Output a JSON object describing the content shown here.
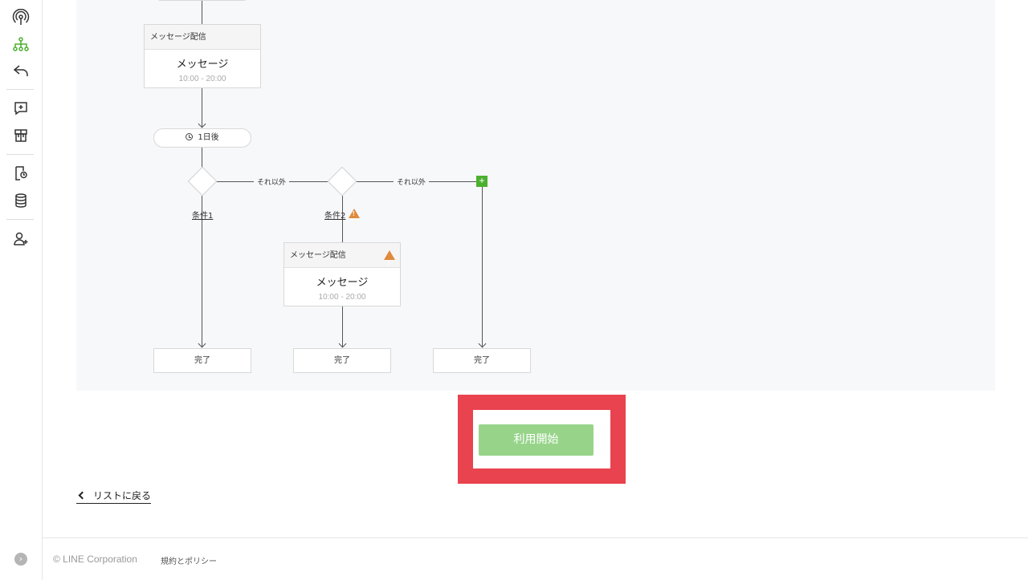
{
  "sidebar": {
    "icons": [
      "broadcast-icon",
      "flow-icon",
      "reply-icon",
      "add-message-icon",
      "gift-icon",
      "document-icon",
      "database-icon",
      "add-user-icon"
    ],
    "expand": "›",
    "accent": "#4cb02f"
  },
  "flow": {
    "message1": {
      "header": "メッセージ配信",
      "title": "メッセージ",
      "time": "10:00 - 20:00"
    },
    "wait": {
      "label": "1日後"
    },
    "else1": "それ以外",
    "else2": "それ以外",
    "cond1": "条件1",
    "cond2": "条件2",
    "message2": {
      "header": "メッセージ配信",
      "title": "メッセージ",
      "time": "10:00 - 20:00"
    },
    "add": "+",
    "done1": "完了",
    "done2": "完了",
    "done3": "完了"
  },
  "actions": {
    "start_label": "利用開始",
    "back_label": "リストに戻る"
  },
  "footer": {
    "copyright": "© LINE Corporation",
    "policy": "規約とポリシー"
  },
  "colors": {
    "highlight": "#e8434f",
    "start_button": "#97d48a",
    "warning": "#e08a3c"
  }
}
